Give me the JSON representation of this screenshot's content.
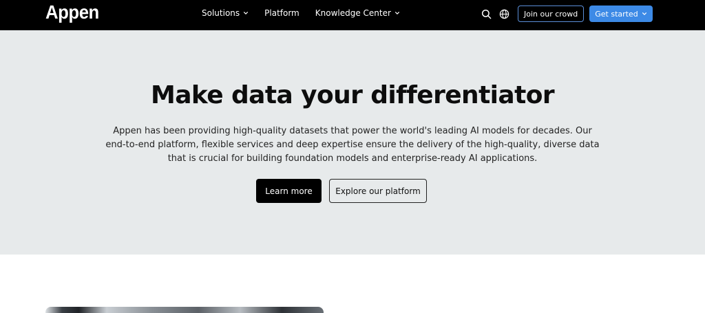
{
  "nav": {
    "logo": "Appen",
    "links": [
      {
        "label": "Solutions",
        "has_dropdown": true
      },
      {
        "label": "Platform",
        "has_dropdown": false
      },
      {
        "label": "Knowledge Center",
        "has_dropdown": true
      }
    ],
    "icons": [
      "search-icon",
      "globe-icon"
    ],
    "join_label": "Join our crowd",
    "started_label": "Get started"
  },
  "hero": {
    "title": "Make data your differentiator",
    "description": "Appen has been providing high-quality datasets that power the world's leading AI models for decades. Our end-to-end platform, flexible services and deep expertise ensure the delivery of the high-quality, diverse data that is crucial for building foundation models and enterprise-ready AI applications.",
    "learn_label": "Learn more",
    "explore_label": "Explore our platform"
  },
  "colors": {
    "nav_bg": "#000000",
    "hero_bg": "#e7eaeb",
    "accent_blue": "#3d8ae6",
    "outline_blue": "#5b8fd9"
  }
}
